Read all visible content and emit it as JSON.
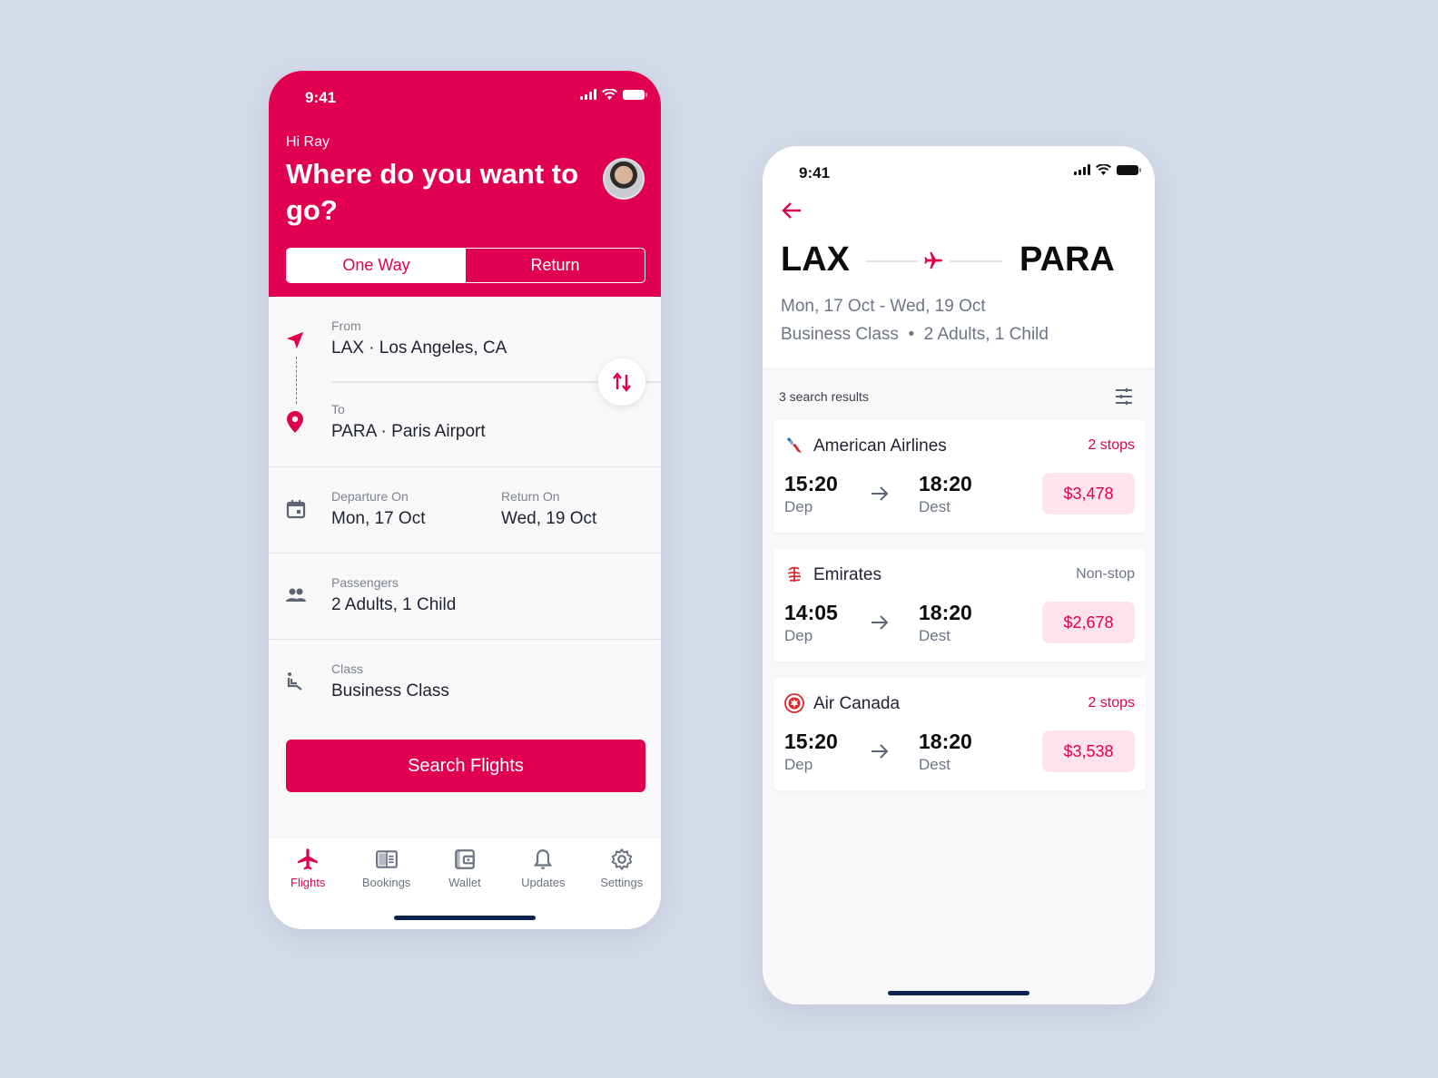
{
  "colors": {
    "brand": "#e0004f",
    "background": "#d3dae8",
    "price_bg": "#fde3ea",
    "stops_red": "#e0004f",
    "stops_gray": "#6d7585"
  },
  "search_screen": {
    "status_time": "9:41",
    "greeting": "Hi Ray",
    "headline": "Where do you want to go?",
    "trip_types": [
      {
        "label": "One Way",
        "active": true
      },
      {
        "label": "Return",
        "active": false
      }
    ],
    "from": {
      "label": "From",
      "value": "LAX · Los Angeles, CA"
    },
    "to": {
      "label": "To",
      "value": "PARA · Paris Airport"
    },
    "departure": {
      "label": "Departure On",
      "value": "Mon, 17 Oct"
    },
    "return": {
      "label": "Return On",
      "value": "Wed, 19 Oct"
    },
    "passengers": {
      "label": "Passengers",
      "value": "2 Adults, 1 Child"
    },
    "class": {
      "label": "Class",
      "value": "Business Class"
    },
    "search_button": "Search Flights",
    "tabs": [
      {
        "label": "Flights",
        "icon": "plane-icon",
        "active": true
      },
      {
        "label": "Bookings",
        "icon": "book-icon",
        "active": false
      },
      {
        "label": "Wallet",
        "icon": "wallet-icon",
        "active": false
      },
      {
        "label": "Updates",
        "icon": "bell-icon",
        "active": false
      },
      {
        "label": "Settings",
        "icon": "gear-icon",
        "active": false
      }
    ]
  },
  "results_screen": {
    "status_time": "9:41",
    "origin": "LAX",
    "destination": "PARA",
    "dates": "Mon, 17 Oct - Wed, 19 Oct",
    "details": "Business Class  •  2 Adults, 1 Child",
    "results_count": "3 search results",
    "flights": [
      {
        "airline": "American Airlines",
        "stops": "2 stops",
        "dep_time": "15:20",
        "dep_label": "Dep",
        "arr_time": "18:20",
        "arr_label": "Dest",
        "price": "$3,478"
      },
      {
        "airline": "Emirates",
        "stops": "Non-stop",
        "dep_time": "14:05",
        "dep_label": "Dep",
        "arr_time": "18:20",
        "arr_label": "Dest",
        "price": "$2,678"
      },
      {
        "airline": "Air Canada",
        "stops": "2 stops",
        "dep_time": "15:20",
        "dep_label": "Dep",
        "arr_time": "18:20",
        "arr_label": "Dest",
        "price": "$3,538"
      }
    ]
  }
}
